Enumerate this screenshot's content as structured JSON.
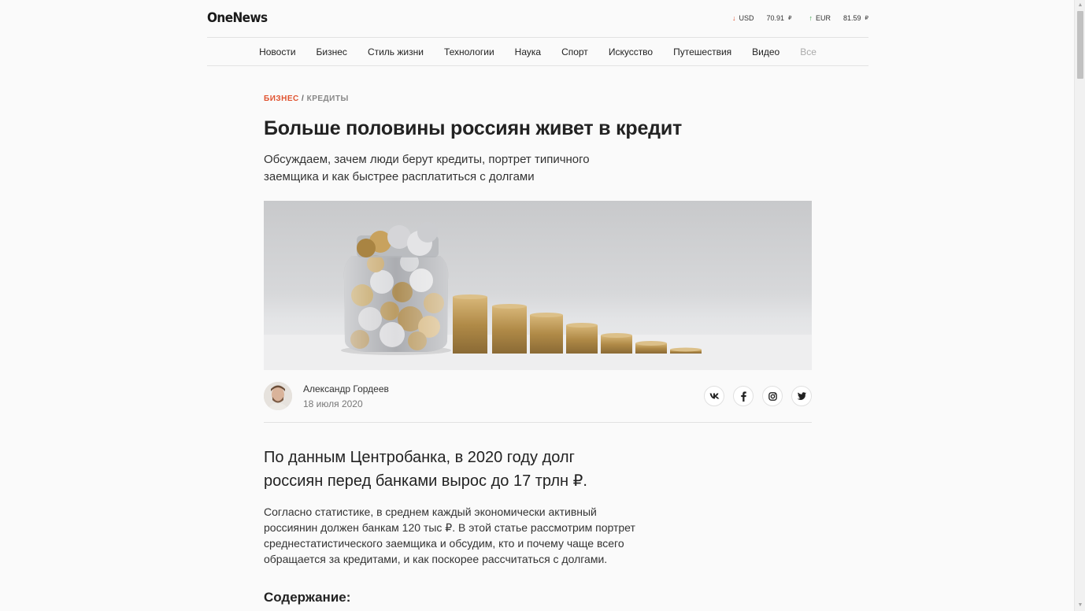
{
  "header": {
    "logo": "OneNews",
    "rates": [
      {
        "arrow": "↓",
        "code": "USD",
        "value": "70.91",
        "unit": "₽"
      },
      {
        "arrow": "↑",
        "code": "EUR",
        "value": "81.59",
        "unit": "₽"
      }
    ]
  },
  "nav": {
    "items": [
      "Новости",
      "Бизнес",
      "Стиль жизни",
      "Технологии",
      "Наука",
      "Спорт",
      "Искусство",
      "Путешествия",
      "Видео",
      "Все"
    ]
  },
  "article": {
    "category": "БИЗНЕС",
    "separator": " / ",
    "subcategory": "КРЕДИТЫ",
    "title": "Больше половины россиян живет в кредит",
    "lead": "Обсуждаем, зачем люди берут кредиты, портрет типичного заемщика и как быстрее расплатиться с долгами",
    "author_name": "Александр Гордеев",
    "date": "18 июля 2020",
    "social": [
      "vk",
      "f",
      "ig",
      "tw"
    ],
    "intro": "По данным Центробанка, в 2020 году долг россиян перед банками вырос до 17 трлн ₽.",
    "body": "Согласно статистике, в среднем каждый экономически активный россиянин должен банкам 120 тыс ₽. В этой статье рассмотрим портрет среднестатистического заемщика и обсудим, кто и почему чаще всего обращается за кредитами, и как поскорее рассчитаться с долгами.",
    "toc_heading": "Содержание:"
  },
  "colors": {
    "accent": "#e0522f",
    "rate_down": "#e0522f",
    "rate_up": "#3aa34a"
  }
}
